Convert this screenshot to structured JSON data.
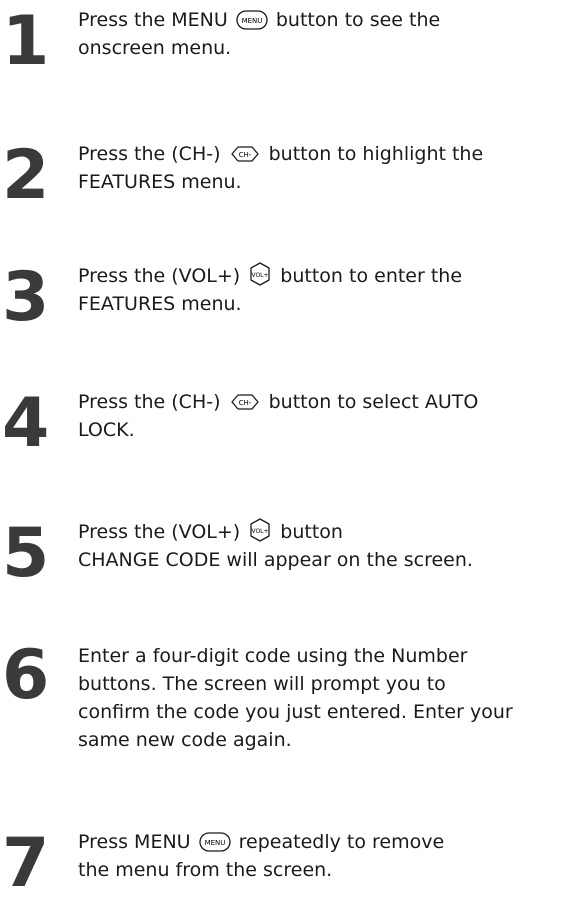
{
  "steps": [
    {
      "number": "1",
      "lines": [
        {
          "before": "Press the MENU ",
          "icon": "menu-button-icon",
          "icon_label": "MENU",
          "after": "  button to see the"
        },
        {
          "text": "onscreen menu."
        }
      ]
    },
    {
      "number": "2",
      "lines": [
        {
          "before": "Press the (CH-) ",
          "icon": "ch-minus-button-icon",
          "icon_label": "CH-",
          "after": " button to highlight the"
        },
        {
          "text": "FEATURES menu."
        }
      ]
    },
    {
      "number": "3",
      "lines": [
        {
          "before": "Press the (VOL+) ",
          "icon": "vol-plus-button-icon",
          "icon_label": "VOL+",
          "after": " button to enter the"
        },
        {
          "text": "FEATURES menu."
        }
      ]
    },
    {
      "number": "4",
      "lines": [
        {
          "before": "Press the (CH-) ",
          "icon": "ch-minus-button-icon",
          "icon_label": "CH-",
          "after": " button to select AUTO"
        },
        {
          "text": "LOCK."
        }
      ]
    },
    {
      "number": "5",
      "lines": [
        {
          "before": "Press the (VOL+) ",
          "icon": "vol-plus-button-icon",
          "icon_label": "VOL+",
          "after": " button"
        },
        {
          "text": "CHANGE CODE will appear on the screen."
        }
      ]
    },
    {
      "number": "6",
      "lines": [
        {
          "text": "Enter a four-digit code using the Number"
        },
        {
          "text": "buttons. The screen will prompt you to"
        },
        {
          "text": "confirm the code you just entered. Enter your"
        },
        {
          "text": "same new code again."
        }
      ]
    },
    {
      "number": "7",
      "lines": [
        {
          "before": "Press MENU ",
          "icon": "menu-button-icon",
          "icon_label": "MENU",
          "after": " repeatedly to remove"
        },
        {
          "text": "the menu from the screen."
        }
      ]
    }
  ]
}
